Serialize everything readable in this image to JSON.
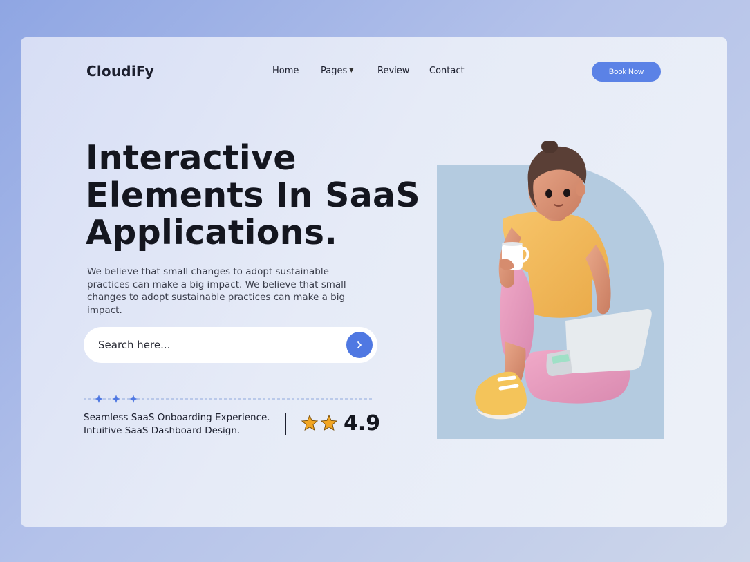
{
  "brand": {
    "logo": "CloudiFy"
  },
  "nav": {
    "items": [
      {
        "label": "Home"
      },
      {
        "label": "Pages",
        "has_dropdown": true
      },
      {
        "label": "Review"
      },
      {
        "label": "Contact"
      }
    ],
    "cta_label": "Book Now"
  },
  "hero": {
    "title_lines": [
      "Interactive",
      "Elements In SaaS",
      "Applications."
    ],
    "description": "We believe that small changes to adopt sustainable practices can make a big impact. We believe that small changes to adopt sustainable practices can make a big impact."
  },
  "search": {
    "placeholder": "Search here...",
    "value": "",
    "button_icon": "chevron-right-icon"
  },
  "features": {
    "line1": "Seamless SaaS Onboarding Experience.",
    "line2": "Intuitive SaaS Dashboard Design."
  },
  "rating": {
    "value": "4.9",
    "stars": 2
  },
  "colors": {
    "accent": "#5b82e6",
    "illustration_bg": "#b4cbe0",
    "star": "#f2a623"
  }
}
